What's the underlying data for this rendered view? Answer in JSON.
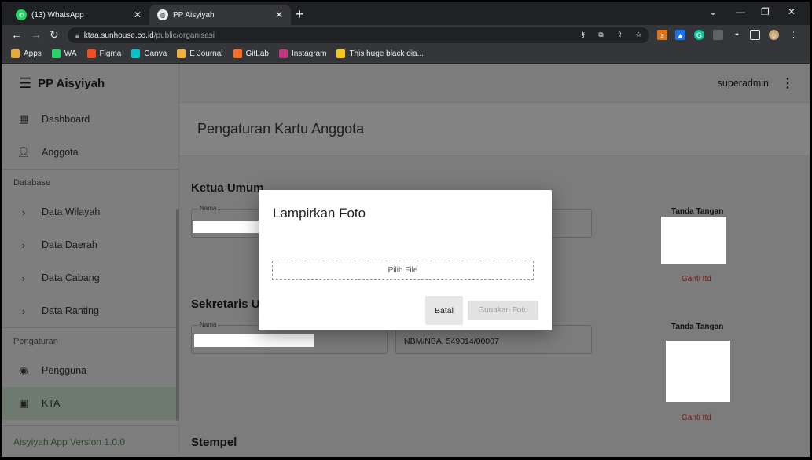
{
  "browser": {
    "tabs": [
      {
        "title": "(13) WhatsApp",
        "favicon": "whatsapp-icon",
        "color": "#25d366"
      },
      {
        "title": "PP Aisyiyah",
        "favicon": "globe-icon",
        "color": "#e8eaed"
      }
    ],
    "url_host": "ktaa.sunhouse.co.id",
    "url_path": "/public/organisasi",
    "bookmarks": [
      {
        "label": "Apps",
        "icon": "apps-grid-icon",
        "color": "#e8a93b"
      },
      {
        "label": "WA",
        "icon": "whatsapp-icon",
        "color": "#25d366"
      },
      {
        "label": "Figma",
        "icon": "figma-icon",
        "color": "#f24e1e"
      },
      {
        "label": "Canva",
        "icon": "canva-icon",
        "color": "#00c4cc"
      },
      {
        "label": "E Journal",
        "icon": "journal-icon",
        "color": "#f0b040"
      },
      {
        "label": "GitLab",
        "icon": "gitlab-icon",
        "color": "#fc6d26"
      },
      {
        "label": "Instagram",
        "icon": "instagram-icon",
        "color": "#c13584"
      },
      {
        "label": "This huge black dia...",
        "icon": "bookmark-page-icon",
        "color": "#f5c518"
      }
    ]
  },
  "sidebar": {
    "title": "PP Aisyiyah",
    "items": [
      {
        "label": "Dashboard",
        "icon": "dashboard-icon"
      },
      {
        "label": "Anggota",
        "icon": "person-icon"
      }
    ],
    "section_database": "Database",
    "database_items": [
      {
        "label": "Data Wilayah"
      },
      {
        "label": "Data Daerah"
      },
      {
        "label": "Data Cabang"
      },
      {
        "label": "Data Ranting"
      }
    ],
    "section_pengaturan": "Pengaturan",
    "pengaturan_items": [
      {
        "label": "Pengguna",
        "icon": "account-circle-icon"
      },
      {
        "label": "KTA",
        "icon": "badge-icon"
      }
    ],
    "footer": "Aisyiyah App Version 1.0.0"
  },
  "topbar": {
    "user": "superadmin"
  },
  "page": {
    "title": "Pengaturan Kartu Anggota",
    "ketua_title": "Ketua Umum",
    "sekretaris_title": "Sekretaris Umum",
    "stempel_title": "Stempel",
    "nama_label": "Nama",
    "nbm_value": "NBM/NBA. 549014/00007",
    "ttd_label": "Tanda Tangan",
    "ganti_ttd": "Ganti ttd"
  },
  "modal": {
    "title": "Lampirkan Foto",
    "dropzone": "Pilih File",
    "cancel": "Batal",
    "confirm": "Gunakan Foto"
  }
}
